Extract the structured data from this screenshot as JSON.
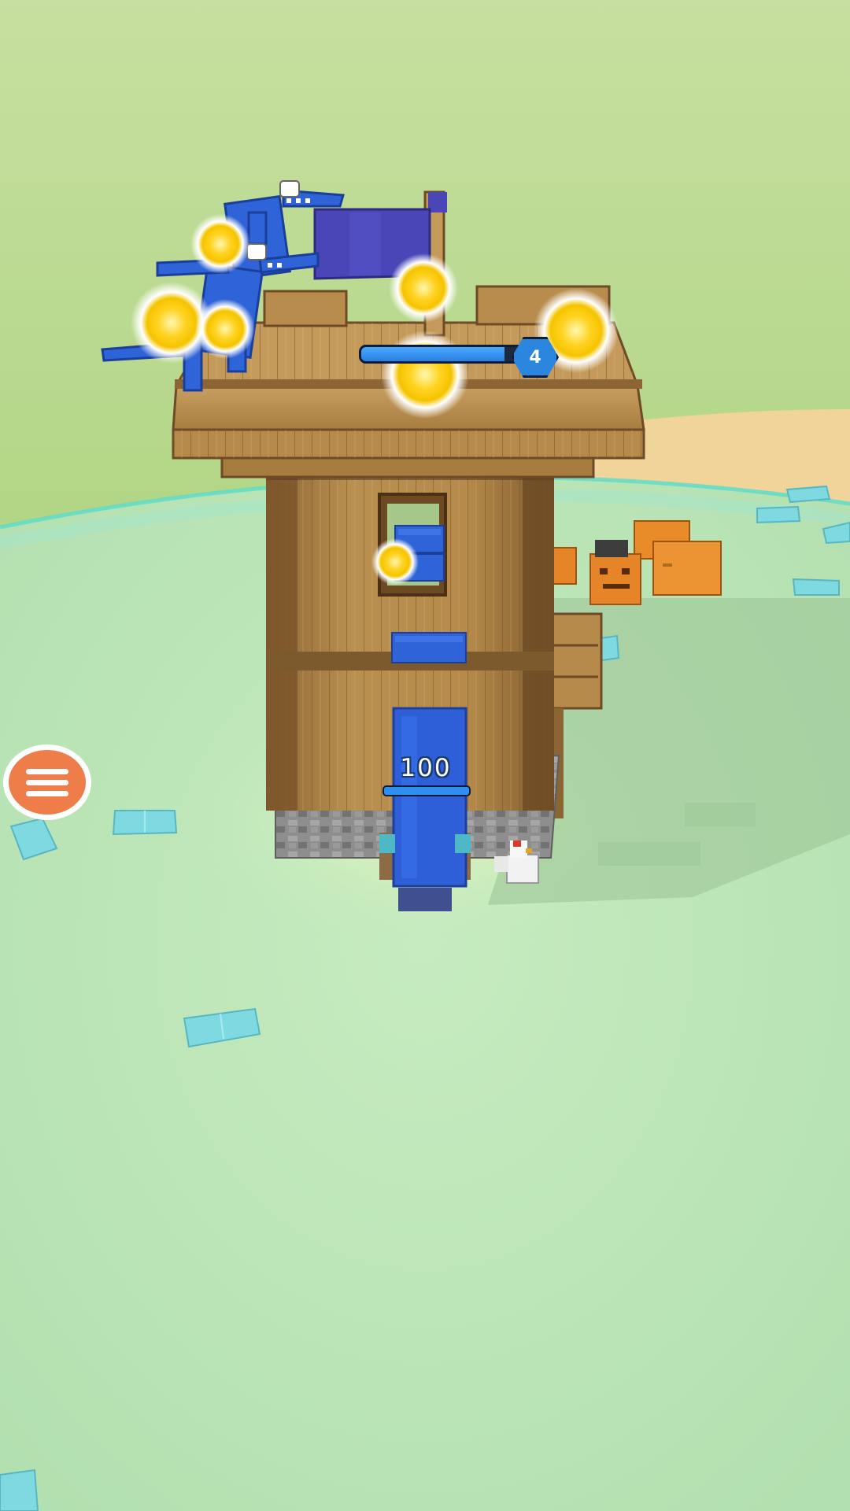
{
  "hud": {
    "menu_icon": "hamburger-menu-icon",
    "player_health": {
      "value": "100",
      "fill_fraction": 1.0
    },
    "enemy": {
      "level": "4",
      "fill_fraction": 0.85
    }
  },
  "colors": {
    "sky_top": "#bcd88e",
    "grass": "#8cc55c",
    "arena": "#b9e3b4",
    "arena_ring": "#5fdcc8",
    "sand": "#f1d49a",
    "wood": "#b58a4a",
    "wood_dark": "#6e4b26",
    "team_blue": "#2f63d8",
    "flag_purple": "#4a46b8",
    "menu_orange": "#ef7d4a",
    "pumpkin": "#e88c2a",
    "diamond_block": "#7fd9e0"
  },
  "scene": {
    "objects": [
      "watch-tower",
      "blue-flag",
      "blue-rainbow-friend-monster",
      "blue-player-character",
      "white-chicken",
      "jack-o-lantern-pumpkins",
      "diamond-blocks",
      "explosion-flowers"
    ]
  }
}
